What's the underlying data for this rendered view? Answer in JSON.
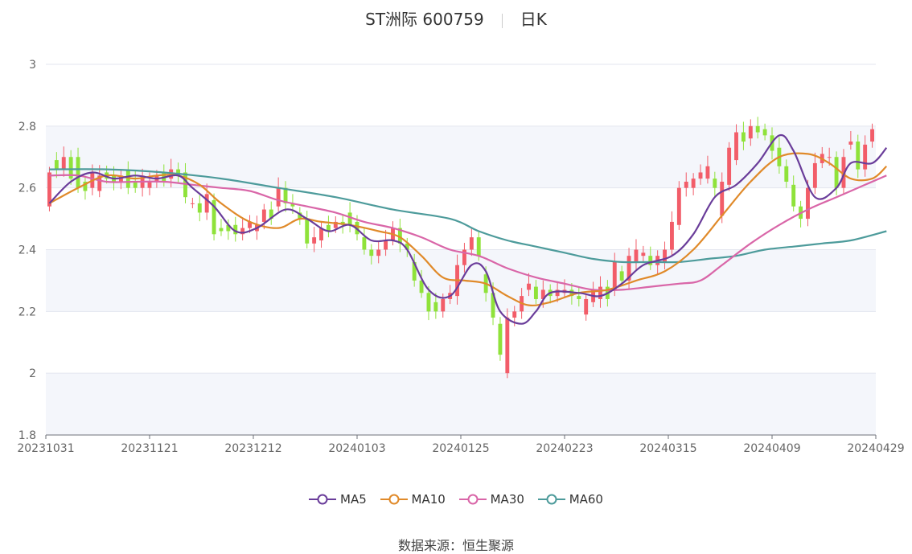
{
  "header": {
    "stock": "ST洲际 600759",
    "period": "日K"
  },
  "source": {
    "label": "数据来源：",
    "value": "恒生聚源"
  },
  "colors": {
    "up": "#f25d69",
    "down": "#8fe23a",
    "ma5": "#6a3d9a",
    "ma10": "#e08a2a",
    "ma30": "#d966a8",
    "ma60": "#4d9b9b",
    "grid": "#e3e6ef",
    "band": "#f4f6fb"
  },
  "chart_data": {
    "type": "candlestick",
    "title": "ST洲际 600759",
    "period": "日K",
    "ylim": [
      1.8,
      3.0
    ],
    "yticks": [
      "1.8",
      "2",
      "2.2",
      "2.4",
      "2.6",
      "2.8",
      "3"
    ],
    "xticks": [
      "20231031",
      "20231121",
      "20231212",
      "20240103",
      "20240125",
      "20240223",
      "20240315",
      "20240409",
      "20240429"
    ],
    "legend": [
      "MA5",
      "MA10",
      "MA30",
      "MA60"
    ],
    "legend_position": "bottom",
    "candles": [
      [
        2.54,
        2.65
      ],
      [
        2.69,
        2.66
      ],
      [
        2.66,
        2.7
      ],
      [
        2.7,
        2.63
      ],
      [
        2.7,
        2.6
      ],
      [
        2.62,
        2.59
      ],
      [
        2.6,
        2.65
      ],
      [
        2.59,
        2.64
      ],
      [
        2.65,
        2.63
      ],
      [
        2.64,
        2.62
      ],
      [
        2.62,
        2.64
      ],
      [
        2.66,
        2.6
      ],
      [
        2.62,
        2.6
      ],
      [
        2.6,
        2.64
      ],
      [
        2.6,
        2.62
      ],
      [
        2.62,
        2.64
      ],
      [
        2.65,
        2.62
      ],
      [
        2.63,
        2.66
      ],
      [
        2.66,
        2.64
      ],
      [
        2.65,
        2.57
      ],
      [
        2.55,
        2.55
      ],
      [
        2.55,
        2.52
      ],
      [
        2.52,
        2.58
      ],
      [
        2.56,
        2.45
      ],
      [
        2.47,
        2.46
      ],
      [
        2.48,
        2.46
      ],
      [
        2.48,
        2.45
      ],
      [
        2.45,
        2.47
      ],
      [
        2.47,
        2.49
      ],
      [
        2.46,
        2.48
      ],
      [
        2.49,
        2.53
      ],
      [
        2.53,
        2.5
      ],
      [
        2.54,
        2.6
      ],
      [
        2.6,
        2.55
      ],
      [
        2.55,
        2.54
      ],
      [
        2.52,
        2.5
      ],
      [
        2.5,
        2.42
      ],
      [
        2.42,
        2.44
      ],
      [
        2.43,
        2.47
      ],
      [
        2.48,
        2.46
      ],
      [
        2.47,
        2.49
      ],
      [
        2.49,
        2.48
      ],
      [
        2.52,
        2.48
      ],
      [
        2.49,
        2.45
      ],
      [
        2.44,
        2.4
      ],
      [
        2.4,
        2.38
      ],
      [
        2.38,
        2.4
      ],
      [
        2.4,
        2.43
      ],
      [
        2.43,
        2.47
      ],
      [
        2.47,
        2.42
      ],
      [
        2.42,
        2.4
      ],
      [
        2.36,
        2.3
      ],
      [
        2.3,
        2.26
      ],
      [
        2.26,
        2.2
      ],
      [
        2.23,
        2.2
      ],
      [
        2.2,
        2.24
      ],
      [
        2.24,
        2.26
      ],
      [
        2.25,
        2.35
      ],
      [
        2.35,
        2.4
      ],
      [
        2.4,
        2.44
      ],
      [
        2.44,
        2.38
      ],
      [
        2.32,
        2.26
      ],
      [
        2.26,
        2.18
      ],
      [
        2.16,
        2.06
      ],
      [
        2.0,
        2.18
      ],
      [
        2.18,
        2.2
      ],
      [
        2.2,
        2.25
      ],
      [
        2.27,
        2.29
      ],
      [
        2.28,
        2.24
      ],
      [
        2.24,
        2.27
      ],
      [
        2.27,
        2.25
      ],
      [
        2.25,
        2.27
      ],
      [
        2.26,
        2.27
      ],
      [
        2.27,
        2.25
      ],
      [
        2.25,
        2.24
      ],
      [
        2.19,
        2.24
      ],
      [
        2.23,
        2.27
      ],
      [
        2.24,
        2.28
      ],
      [
        2.28,
        2.24
      ],
      [
        2.27,
        2.36
      ],
      [
        2.33,
        2.3
      ],
      [
        2.3,
        2.38
      ],
      [
        2.36,
        2.4
      ],
      [
        2.38,
        2.39
      ],
      [
        2.38,
        2.35
      ],
      [
        2.35,
        2.38
      ],
      [
        2.36,
        2.4
      ],
      [
        2.4,
        2.49
      ],
      [
        2.48,
        2.6
      ],
      [
        2.6,
        2.62
      ],
      [
        2.6,
        2.63
      ],
      [
        2.63,
        2.65
      ],
      [
        2.63,
        2.67
      ],
      [
        2.63,
        2.6
      ],
      [
        2.51,
        2.62
      ],
      [
        2.61,
        2.73
      ],
      [
        2.69,
        2.78
      ],
      [
        2.78,
        2.75
      ],
      [
        2.76,
        2.8
      ],
      [
        2.8,
        2.78
      ],
      [
        2.79,
        2.77
      ],
      [
        2.77,
        2.72
      ],
      [
        2.73,
        2.67
      ],
      [
        2.67,
        2.62
      ],
      [
        2.61,
        2.54
      ],
      [
        2.54,
        2.5
      ],
      [
        2.5,
        2.6
      ],
      [
        2.6,
        2.68
      ],
      [
        2.68,
        2.71
      ],
      [
        2.7,
        2.7
      ],
      [
        2.7,
        2.6
      ],
      [
        2.6,
        2.7
      ],
      [
        2.74,
        2.75
      ],
      [
        2.75,
        2.66
      ],
      [
        2.66,
        2.74
      ],
      [
        2.75,
        2.79
      ]
    ],
    "ma5": [
      [
        0,
        2.55
      ],
      [
        3,
        2.62
      ],
      [
        6,
        2.65
      ],
      [
        9,
        2.63
      ],
      [
        12,
        2.64
      ],
      [
        15,
        2.63
      ],
      [
        18,
        2.64
      ],
      [
        20,
        2.6
      ],
      [
        23,
        2.54
      ],
      [
        26,
        2.46
      ],
      [
        29,
        2.47
      ],
      [
        33,
        2.53
      ],
      [
        36,
        2.5
      ],
      [
        39,
        2.46
      ],
      [
        42,
        2.48
      ],
      [
        45,
        2.43
      ],
      [
        48,
        2.43
      ],
      [
        50,
        2.4
      ],
      [
        53,
        2.27
      ],
      [
        56,
        2.25
      ],
      [
        59,
        2.35
      ],
      [
        61,
        2.33
      ],
      [
        63,
        2.2
      ],
      [
        66,
        2.16
      ],
      [
        68,
        2.2
      ],
      [
        70,
        2.26
      ],
      [
        74,
        2.26
      ],
      [
        77,
        2.25
      ],
      [
        80,
        2.29
      ],
      [
        83,
        2.35
      ],
      [
        87,
        2.38
      ],
      [
        90,
        2.45
      ],
      [
        93,
        2.57
      ],
      [
        96,
        2.61
      ],
      [
        99,
        2.68
      ],
      [
        102,
        2.77
      ],
      [
        104,
        2.72
      ],
      [
        107,
        2.57
      ],
      [
        110,
        2.6
      ],
      [
        112,
        2.68
      ],
      [
        115,
        2.68
      ],
      [
        117,
        2.73
      ]
    ],
    "ma10": [
      [
        0,
        2.55
      ],
      [
        4,
        2.6
      ],
      [
        8,
        2.64
      ],
      [
        12,
        2.63
      ],
      [
        15,
        2.64
      ],
      [
        18,
        2.64
      ],
      [
        21,
        2.61
      ],
      [
        24,
        2.55
      ],
      [
        28,
        2.49
      ],
      [
        32,
        2.47
      ],
      [
        35,
        2.5
      ],
      [
        38,
        2.49
      ],
      [
        42,
        2.48
      ],
      [
        46,
        2.46
      ],
      [
        49,
        2.44
      ],
      [
        52,
        2.38
      ],
      [
        55,
        2.31
      ],
      [
        58,
        2.3
      ],
      [
        61,
        2.29
      ],
      [
        64,
        2.25
      ],
      [
        67,
        2.22
      ],
      [
        70,
        2.23
      ],
      [
        74,
        2.26
      ],
      [
        78,
        2.27
      ],
      [
        82,
        2.3
      ],
      [
        86,
        2.33
      ],
      [
        90,
        2.4
      ],
      [
        94,
        2.51
      ],
      [
        98,
        2.62
      ],
      [
        102,
        2.7
      ],
      [
        106,
        2.71
      ],
      [
        109,
        2.68
      ],
      [
        112,
        2.63
      ],
      [
        115,
        2.63
      ],
      [
        117,
        2.67
      ]
    ],
    "ma30": [
      [
        0,
        2.64
      ],
      [
        4,
        2.64
      ],
      [
        8,
        2.62
      ],
      [
        12,
        2.62
      ],
      [
        16,
        2.62
      ],
      [
        20,
        2.61
      ],
      [
        24,
        2.6
      ],
      [
        28,
        2.59
      ],
      [
        32,
        2.56
      ],
      [
        36,
        2.54
      ],
      [
        40,
        2.52
      ],
      [
        44,
        2.49
      ],
      [
        48,
        2.47
      ],
      [
        52,
        2.44
      ],
      [
        56,
        2.4
      ],
      [
        60,
        2.38
      ],
      [
        64,
        2.34
      ],
      [
        68,
        2.31
      ],
      [
        72,
        2.29
      ],
      [
        76,
        2.27
      ],
      [
        80,
        2.27
      ],
      [
        84,
        2.28
      ],
      [
        88,
        2.29
      ],
      [
        91,
        2.3
      ],
      [
        94,
        2.35
      ],
      [
        98,
        2.42
      ],
      [
        102,
        2.48
      ],
      [
        106,
        2.53
      ],
      [
        110,
        2.57
      ],
      [
        114,
        2.61
      ],
      [
        117,
        2.64
      ]
    ],
    "ma60": [
      [
        0,
        2.66
      ],
      [
        8,
        2.66
      ],
      [
        16,
        2.65
      ],
      [
        24,
        2.63
      ],
      [
        32,
        2.6
      ],
      [
        40,
        2.57
      ],
      [
        48,
        2.53
      ],
      [
        56,
        2.5
      ],
      [
        60,
        2.46
      ],
      [
        64,
        2.43
      ],
      [
        68,
        2.41
      ],
      [
        72,
        2.39
      ],
      [
        76,
        2.37
      ],
      [
        80,
        2.36
      ],
      [
        84,
        2.36
      ],
      [
        88,
        2.36
      ],
      [
        92,
        2.37
      ],
      [
        96,
        2.38
      ],
      [
        100,
        2.4
      ],
      [
        104,
        2.41
      ],
      [
        108,
        2.42
      ],
      [
        112,
        2.43
      ],
      [
        117,
        2.46
      ]
    ]
  }
}
